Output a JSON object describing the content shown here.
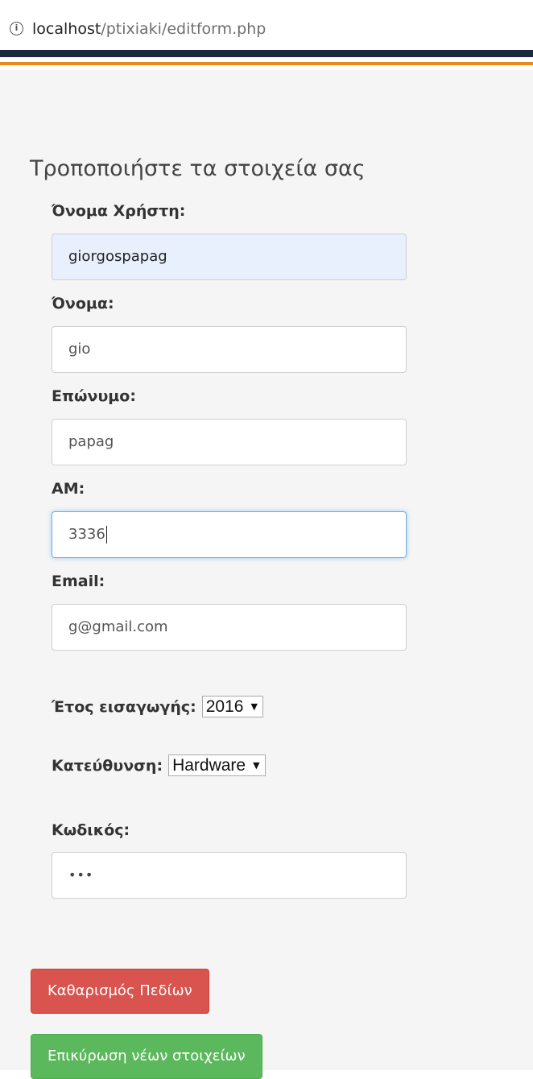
{
  "browser": {
    "url_host": "localhost",
    "url_path": "/ptixiaki/editform.php",
    "info_glyph": "i"
  },
  "form": {
    "title": "Τροποποιήστε τα στοιχεία σας",
    "username": {
      "label": "Όνομα Χρήστη:",
      "value": "giorgospapag"
    },
    "firstname": {
      "label": "Όνομα:",
      "value": "gio"
    },
    "lastname": {
      "label": "Επώνυμο:",
      "value": "papag"
    },
    "am": {
      "label": "AM:",
      "value": "3336"
    },
    "email": {
      "label": "Email:",
      "value": "g@gmail.com"
    },
    "year": {
      "label": "Έτος εισαγωγής:",
      "selected": "2016"
    },
    "direction": {
      "label": "Κατεύθυνση:",
      "selected": "Hardware"
    },
    "password": {
      "label": "Κωδικός:",
      "value": "•••"
    },
    "select_arrow": "▼",
    "clear_button": "Καθαρισμός Πεδίων",
    "submit_button": "Επικύρωση νέων στοιχείων"
  },
  "colors": {
    "danger": "#d9534f",
    "success": "#5cb85c",
    "focus": "#66afe9",
    "autofill": "#e8f0fe",
    "header_dark": "#1c2a3f",
    "header_accent": "#e88a1a"
  }
}
